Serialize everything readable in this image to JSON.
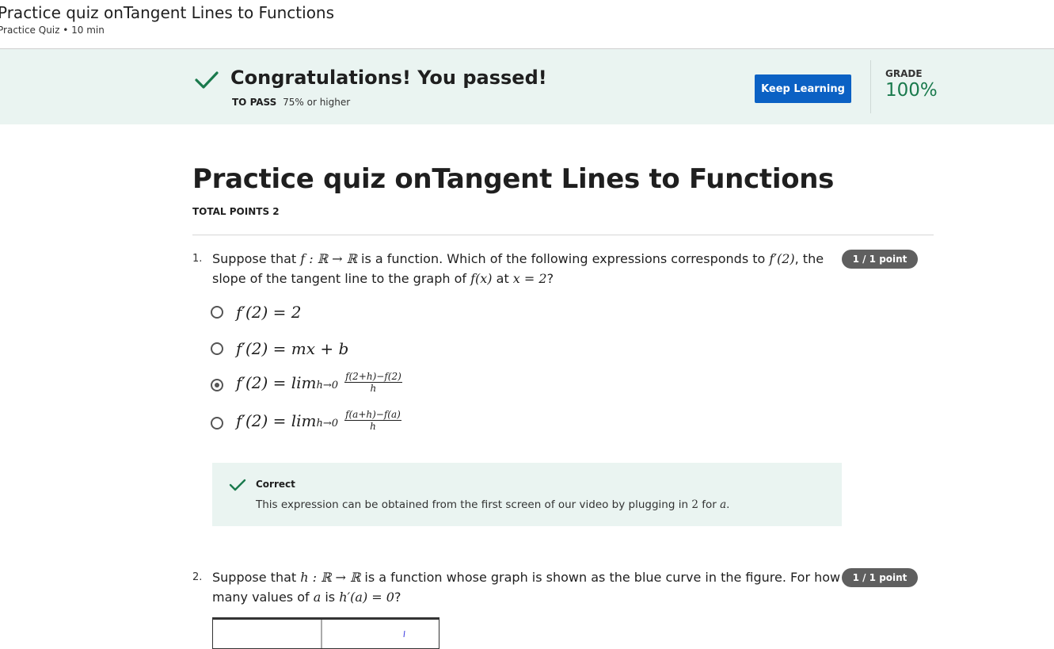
{
  "header": {
    "title": "Practice quiz onTangent Lines to Functions",
    "subtitle": "Practice Quiz • 10 min"
  },
  "banner": {
    "message": "Congratulations! You passed!",
    "to_pass_label": "TO PASS",
    "to_pass_value": "75% or higher",
    "keep_learning_label": "Keep Learning",
    "grade_label": "GRADE",
    "grade_value": "100%",
    "accent_color": "#0b61c4",
    "success_color": "#1a7a4d",
    "icon": "check-icon"
  },
  "quiz": {
    "title": "Practice quiz onTangent Lines to Functions",
    "total_points": "TOTAL POINTS 2"
  },
  "questions": [
    {
      "number": "1.",
      "text_parts": {
        "a": "Suppose that ",
        "m1": "f : ℝ → ℝ",
        "b": " is a function. Which of the following expressions corresponds to ",
        "m2": "f′(2)",
        "c": ", the slope of the tangent line to the graph of ",
        "m3": "f(x)",
        "d": " at ",
        "m4": "x = 2",
        "e": "?"
      },
      "points": "1 / 1 point",
      "options": [
        {
          "text": "f′(2) = 2",
          "selected": false
        },
        {
          "text": "f′(2) = mx + b",
          "selected": false
        },
        {
          "lhs": "f′(2) = lim",
          "sub": "h→0",
          "num": "f(2+h)−f(2)",
          "den": "h",
          "selected": true
        },
        {
          "lhs": "f′(2) = lim",
          "sub": "h→0",
          "num": "f(a+h)−f(a)",
          "den": "h",
          "selected": false
        }
      ],
      "feedback": {
        "title": "Correct",
        "text_a": "This expression can be obtained from the first screen of our video by plugging in ",
        "m1": "2",
        "text_b": " for ",
        "m2": "a",
        "text_c": "."
      }
    },
    {
      "number": "2.",
      "text_parts": {
        "a": "Suppose that ",
        "m1": "h : ℝ → ℝ",
        "b": " is a function whose graph is shown as the blue curve in the figure. For how many values of ",
        "m2": "a",
        "c": " is ",
        "m3": "h′(a) = 0",
        "d": "?"
      },
      "points": "1 / 1 point",
      "curve_color": "#3a3adf"
    }
  ]
}
